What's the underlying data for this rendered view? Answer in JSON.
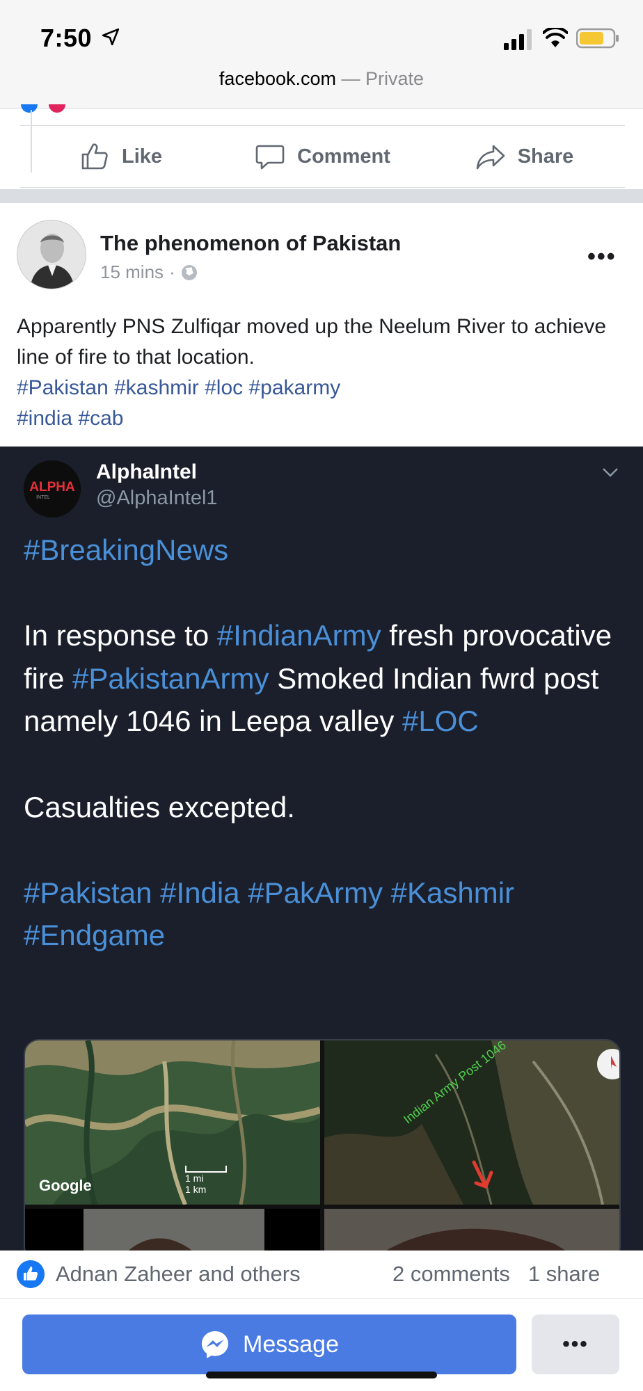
{
  "status_bar": {
    "time": "7:50",
    "url_domain": "facebook.com",
    "url_mode": "Private"
  },
  "previous_post_actions": {
    "like": "Like",
    "comment": "Comment",
    "share": "Share"
  },
  "post": {
    "author": "The phenomenon of Pakistan",
    "time": "15 mins",
    "text": "Apparently PNS Zulfiqar moved up the Neelum River to achieve line of fire to that location.",
    "hashtags_line1": "#Pakistan #kashmir #loc #pakarmy",
    "hashtags_line2": "#india #cab"
  },
  "tweet": {
    "name": "AlphaIntel",
    "handle": "@AlphaIntel1",
    "avatar_text": "ALPHA",
    "avatar_subtext": "INTEL",
    "tag_breaking": "#BreakingNews",
    "text_1": "In response to",
    "tag_indianarmy": "#IndianArmy",
    "text_2": "fresh provocative fire",
    "tag_pakistanarmy": "#PakistanArmy",
    "text_3": "Smoked Indian fwrd post namely 1046 in Leepa valley",
    "tag_loc": "#LOC",
    "text_4": "Casualties excepted.",
    "tag_pakistan": "#Pakistan",
    "tag_india": "#India",
    "tag_pakarmy": "#PakArmy",
    "tag_kashmir": "#Kashmir",
    "tag_endgame": "#Endgame",
    "media": {
      "map_attribution": "Google",
      "scale_mi": "1 mi",
      "scale_km": "1 km",
      "post_label": "Indian Army Post 1046"
    }
  },
  "engagement": {
    "reactors": "Adnan Zaheer and others",
    "comments": "2 comments",
    "shares": "1 share"
  },
  "bottom_bar": {
    "message_label": "Message",
    "more_label": "•••"
  },
  "colors": {
    "facebook_blue": "#4a7be3",
    "hashtag_blue": "#385898",
    "tweet_bg": "#1b1f2b",
    "tweet_link": "#4a90d9"
  }
}
